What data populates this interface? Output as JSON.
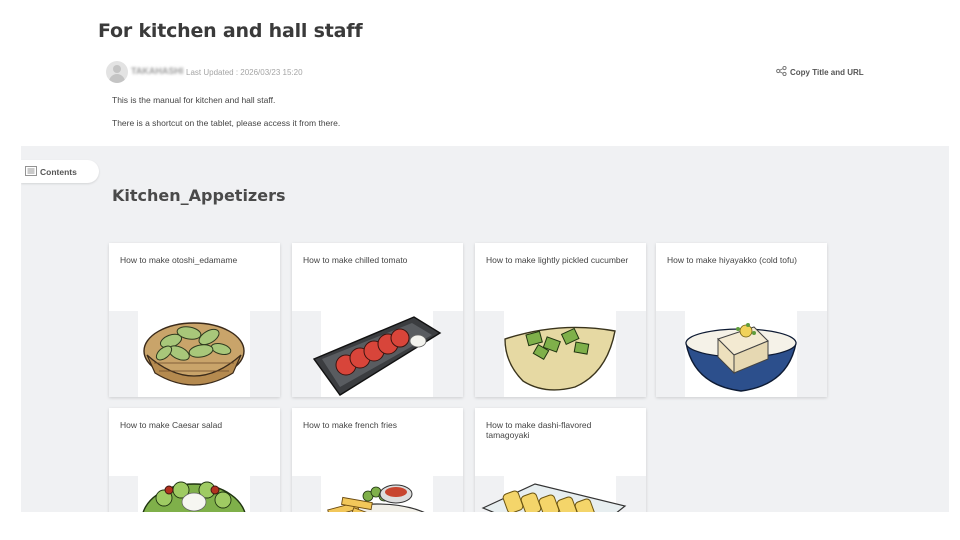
{
  "page": {
    "title": "For kitchen and hall staff",
    "author": "TAKAHASHI",
    "last_updated": "Last Updated : 2026/03/23 15:20",
    "copy_link_label": "Copy Title and URL",
    "intro_1": "This is the manual for kitchen and hall staff.",
    "intro_2": "There is a shortcut on the tablet, please access it from there."
  },
  "toc": {
    "label": "Contents"
  },
  "section": {
    "title": "Kitchen_Appetizers",
    "cards": [
      {
        "title": "How to make otoshi_edamame",
        "image": "edamame-basket"
      },
      {
        "title": "How to make chilled tomato",
        "image": "tomato-plate"
      },
      {
        "title": "How to make lightly pickled cucumber",
        "image": "cucumber-bowl"
      },
      {
        "title": "How to make hiyayakko (cold tofu)",
        "image": "tofu-bowl"
      },
      {
        "title": "How to make Caesar salad",
        "image": "caesar-salad"
      },
      {
        "title": "How to make french fries",
        "image": "french-fries"
      },
      {
        "title": "How to make dashi-flavored tamagoyaki",
        "image": "tamagoyaki-plate"
      }
    ]
  }
}
